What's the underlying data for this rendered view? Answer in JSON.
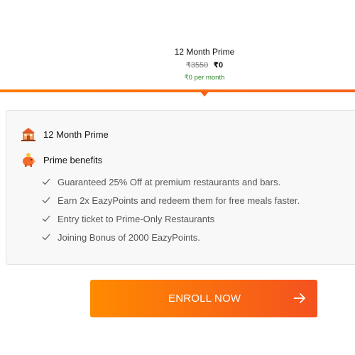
{
  "plan": {
    "title": "12 Month Prime",
    "old_price": "₹3550",
    "new_price": "₹0",
    "per_month": "₹0 per month"
  },
  "benefits_card": {
    "plan_label": "12 Month Prime",
    "benefits_heading": "Prime benefits",
    "benefits": [
      "Guaranteed 25% Off at premium restaurants and bars.",
      "Earn 2x EazyPoints and redeem them for free meals faster.",
      "Entry ticket to Prime-Only Restaurants",
      "Joining Bonus of 2000 EazyPoints."
    ]
  },
  "enroll_button": {
    "label": "ENROLL NOW",
    "icon": "arrow-right-icon"
  },
  "colors": {
    "accent": "#f5621f",
    "accent_start": "#ff8a00",
    "per_month_green": "#2e8b2e",
    "card_bg": "#f8f8f8"
  }
}
